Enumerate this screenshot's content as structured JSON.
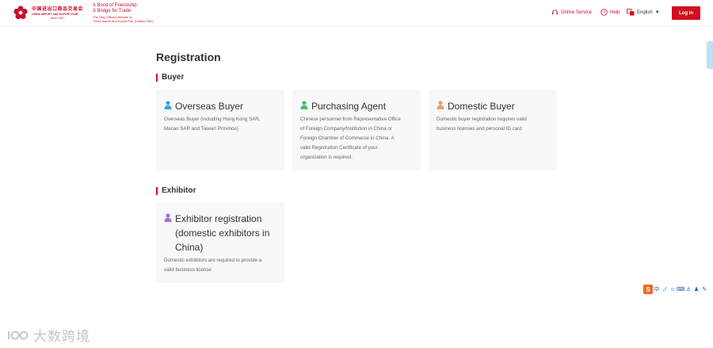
{
  "header": {
    "logo_cn": "中国进出口商品交易会",
    "logo_en": "CHINA IMPORT AND EXPORT FAIR",
    "logo_since": "Since 1957",
    "tagline_1": "A Bond of Friendship",
    "tagline_2": "A Bridge for Trade",
    "tagline_3": "The Only Official Website of",
    "tagline_4": "China Import and Export Fair (Canton Fair)",
    "online_service": "Online Service",
    "help": "Help",
    "language": "English",
    "login": "Log In"
  },
  "page": {
    "title": "Registration"
  },
  "buyer_section": {
    "title": "Buyer",
    "cards": [
      {
        "title": "Overseas Buyer",
        "desc_1": "Overseas Buyer (including Hong Kong SAR,",
        "desc_2": "Macao SAR and Taiwan Province)",
        "icon_color": "#3fa3e3"
      },
      {
        "title": "Purchasing Agent",
        "desc_1": "Chinese personnel from Representative Office",
        "desc_2": "of Foreign Company/Institution in China or",
        "desc_3": "Foreign Chamber of Commerce in China. A",
        "desc_4": "valid Registration Certificate of your",
        "desc_5": "organization is required.",
        "icon_color": "#4cc068"
      },
      {
        "title": "Domestic Buyer",
        "desc_1": "Domestic buyer registration requires valid",
        "desc_2": "business licenses and personal ID card",
        "icon_color": "#e8a35e"
      }
    ]
  },
  "exhibitor_section": {
    "title": "Exhibitor",
    "cards": [
      {
        "title_1": "Exhibitor registration",
        "title_2": "(domestic exhibitors in",
        "title_3": "China)",
        "desc_1": "Domestic exhibitors are required to provide a",
        "desc_2": "valid business license",
        "icon_color": "#a66ed8"
      }
    ]
  },
  "toolbar": {
    "logo": "S",
    "items": [
      "中",
      "ノ",
      "☺",
      "⌨",
      "♙",
      "♟",
      "✎"
    ]
  },
  "watermark": {
    "text": "大数跨境"
  },
  "colors": {
    "brand_red": "#d0101c",
    "card_bg": "#f6f8fc"
  }
}
